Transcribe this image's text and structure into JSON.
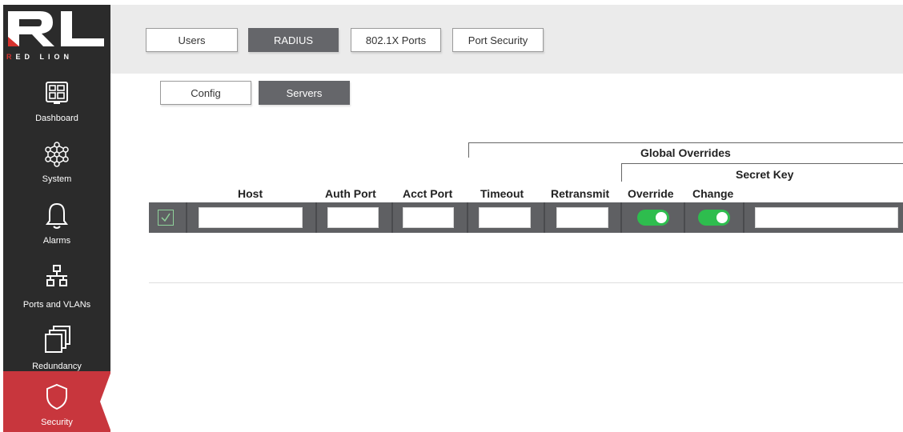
{
  "brand": {
    "logo_text": "RED LION"
  },
  "sidebar": {
    "items": [
      {
        "label": "Dashboard",
        "icon": "dashboard-icon",
        "active": false
      },
      {
        "label": "System",
        "icon": "network-hub-icon",
        "active": false
      },
      {
        "label": "Alarms",
        "icon": "bell-icon",
        "active": false
      },
      {
        "label": "Ports and VLANs",
        "icon": "network-tree-icon",
        "active": false
      },
      {
        "label": "Redundancy",
        "icon": "stacked-windows-icon",
        "active": false
      },
      {
        "label": "Security",
        "icon": "shield-icon",
        "active": true
      }
    ],
    "active_color": "#c8363d"
  },
  "tabs": [
    {
      "label": "Users",
      "active": false
    },
    {
      "label": "RADIUS",
      "active": true
    },
    {
      "label": "802.1X Ports",
      "active": false
    },
    {
      "label": "Port Security",
      "active": false
    }
  ],
  "subtabs": [
    {
      "label": "Config",
      "active": false
    },
    {
      "label": "Servers",
      "active": true
    }
  ],
  "table": {
    "group_header": "Global Overrides",
    "subgroup_header": "Secret Key",
    "columns": [
      "Host",
      "Auth Port",
      "Acct Port",
      "Timeout",
      "Retransmit",
      "Override",
      "Change"
    ],
    "row": {
      "selected": true,
      "host": "",
      "auth_port": "",
      "acct_port": "",
      "timeout": "",
      "retransmit": "",
      "override_on": true,
      "change_on": true,
      "secret_key": ""
    }
  },
  "colors": {
    "toggle_on": "#2ebd4e",
    "active_tab": "#65666a",
    "row_bg": "#5f6063"
  }
}
